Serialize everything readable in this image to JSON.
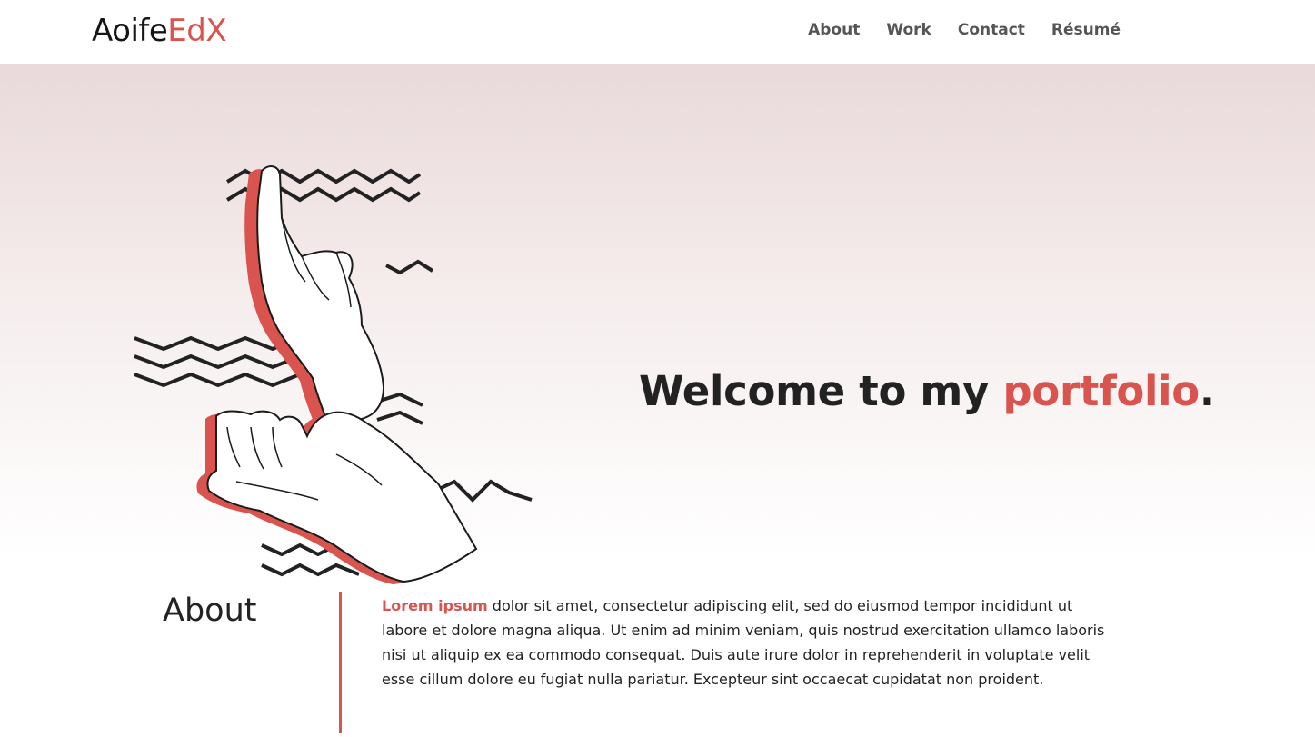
{
  "brand": {
    "part1": "Aoife",
    "part2": "EdX"
  },
  "nav": {
    "items": [
      {
        "label": "About"
      },
      {
        "label": "Work"
      },
      {
        "label": "Contact"
      },
      {
        "label": "Résumé"
      }
    ]
  },
  "hero": {
    "heading_prefix": "Welcome to my ",
    "heading_accent": "portfolio",
    "heading_suffix": "."
  },
  "about": {
    "title": "About",
    "lead": "Lorem ipsum",
    "text": " dolor sit amet, consectetur adipiscing elit, sed do eiusmod tempor incididunt ut labore et dolore magna aliqua. Ut enim ad minim veniam, quis nostrud exercitation ullamco laboris nisi ut aliquip ex ea commodo consequat. Duis aute irure dolor in reprehenderit in voluptate velit esse cillum dolore eu fugiat nulla pariatur. Excepteur sint occaecat cupidatat non proident."
  },
  "colors": {
    "accent": "#d9534f",
    "text": "#222222",
    "nav_text": "#555555",
    "hero_top": "#e9d9da"
  },
  "icons": {
    "hero_illustration": "hands-illustration"
  }
}
